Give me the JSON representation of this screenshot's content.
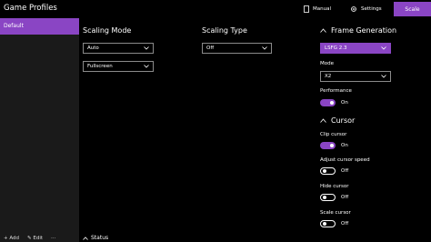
{
  "app": {
    "title": "Game Profiles"
  },
  "toolbar": {
    "manual_label": "Manual",
    "settings_label": "Settings",
    "scale_label": "Scale"
  },
  "sidebar": {
    "profiles": [
      {
        "label": "Default",
        "selected": true
      }
    ],
    "footer": {
      "add_label": "Add",
      "edit_label": "Edit",
      "more_label": "···"
    }
  },
  "scaling_mode": {
    "label": "Scaling Mode",
    "select1": "Auto",
    "select2": "Fullscreen"
  },
  "scaling_type": {
    "label": "Scaling Type",
    "select": "Off"
  },
  "frame_generation": {
    "label": "Frame Generation",
    "select": "LSFG 2.3",
    "mode_label": "Mode",
    "mode_value": "X2",
    "performance_label": "Performance",
    "performance_state": "On"
  },
  "cursor": {
    "label": "Cursor",
    "clip_label": "Clip cursor",
    "clip_state": "On",
    "adjust_label": "Adjust cursor speed",
    "adjust_state": "Off",
    "hide_label": "Hide cursor",
    "hide_state": "Off",
    "scale_label": "Scale cursor",
    "scale_state": "Off"
  },
  "status": {
    "label": "Status"
  },
  "colors": {
    "accent": "#8a45c4",
    "sidebar_bg": "#1a1a1a",
    "bg": "#000000"
  }
}
